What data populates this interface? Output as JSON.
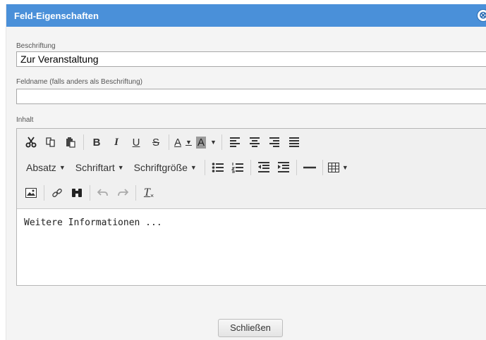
{
  "dialog": {
    "title": "Feld-Eigenschaften",
    "close_glyph": "⊗",
    "caption_label": "Beschriftung",
    "caption_value": "Zur Veranstaltung",
    "fieldname_label": "Feldname (falls anders als Beschriftung)",
    "fieldname_value": "",
    "content_label": "Inhalt",
    "close_button": "Schließen"
  },
  "toolbar": {
    "bold": "B",
    "italic": "I",
    "underline": "U",
    "strike": "S",
    "text_color": "A",
    "bg_color": "A",
    "paragraph": "Absatz",
    "font": "Schriftart",
    "font_size": "Schriftgröße",
    "clear_format": "T"
  },
  "editor": {
    "content": "Weitere Informationen ..."
  },
  "colors": {
    "titlebar": "#4a90d9",
    "dialog_bg": "#f4f4f4"
  }
}
